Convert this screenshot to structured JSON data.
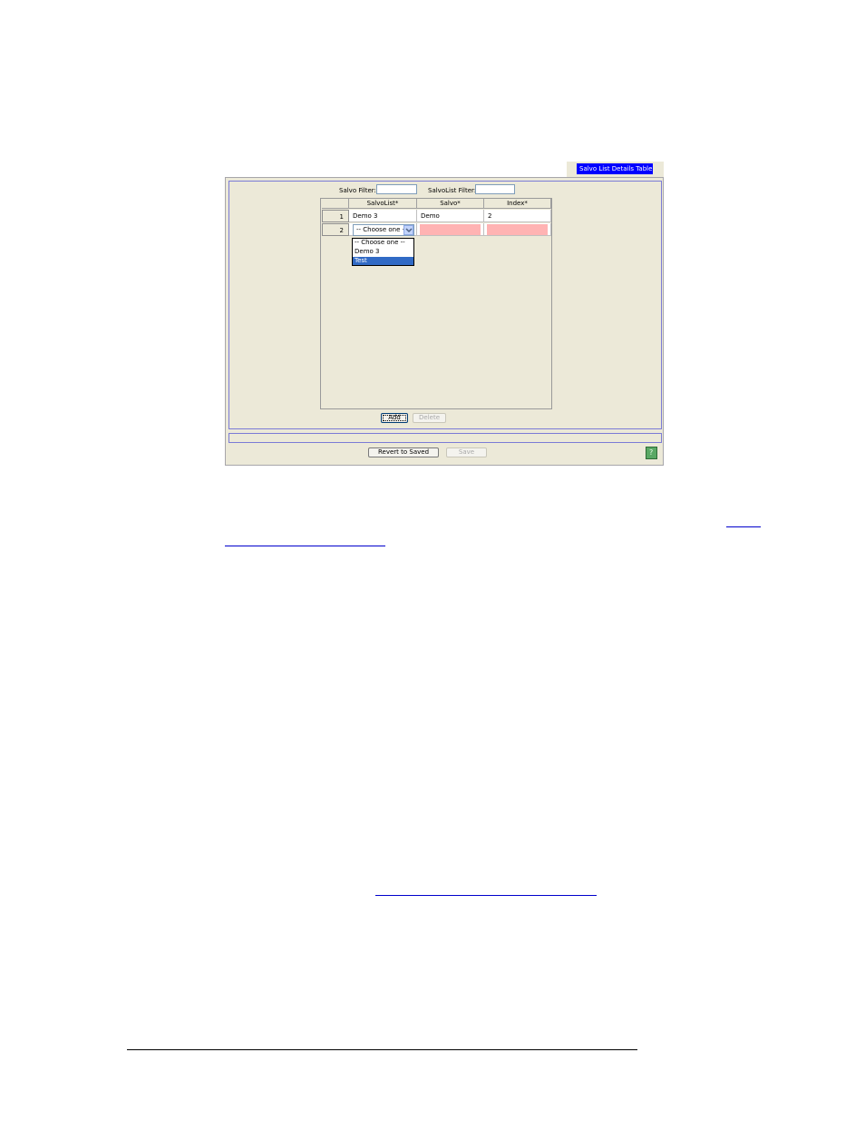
{
  "window": {
    "title": "Salvo List Details Table"
  },
  "filters": {
    "salvo_filter_label": "Salvo Filter:",
    "salvo_filter_value": "",
    "salvolist_filter_label": "SalvoList Filter:",
    "salvolist_filter_value": ""
  },
  "table": {
    "columns": [
      "SalvoList*",
      "Salvo*",
      "Index*"
    ],
    "rows": [
      {
        "num": "1",
        "salvolist": "Demo 3",
        "salvo": "Demo",
        "index": "2"
      },
      {
        "num": "2",
        "salvolist": "-- Choose one --",
        "salvo": "",
        "index": ""
      }
    ]
  },
  "dropdown": {
    "options": [
      "-- Choose one --",
      "Demo 3",
      "Test"
    ],
    "highlighted": "Test"
  },
  "buttons": {
    "add": "Add",
    "delete": "Delete",
    "revert": "Revert to Saved",
    "save": "Save"
  },
  "help": {
    "glyph": "?"
  },
  "colors": {
    "title_bg": "#0000ff",
    "invalid_cell": "#ffb3b3",
    "selection": "#316ac5",
    "panel_bg": "#ece9d8"
  }
}
